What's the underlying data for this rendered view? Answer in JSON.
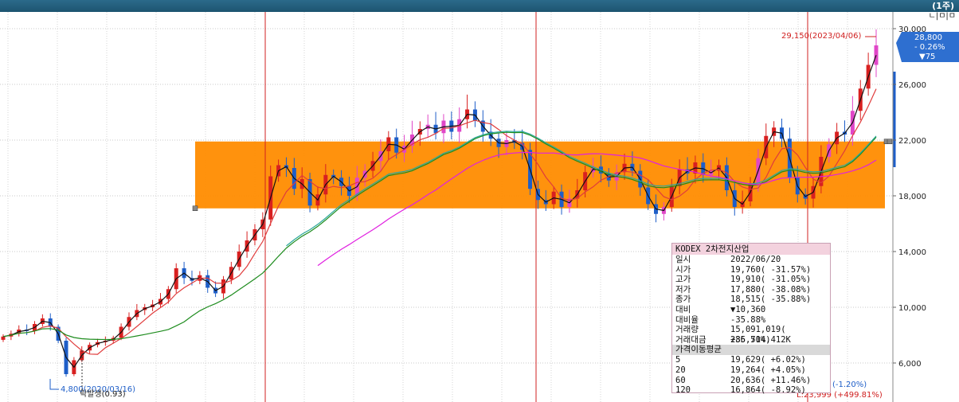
{
  "header": {
    "period": "(1주)",
    "window_controls": "ㄴ|ㅁ|ㅁ"
  },
  "colors": {
    "topbar": "#1d5470",
    "up": "#d82020",
    "down": "#1e5ec8",
    "up_pink": "#e046c8",
    "band": "#ff8c00",
    "ma5": "#111111",
    "ma20": "#e03c3c",
    "ma60": "#1e8c1e",
    "ma120": "#e020e0",
    "ma_teal": "#2aa89a"
  },
  "chart_data": {
    "type": "candlestick",
    "title": "KODEX 2차전지산업",
    "y_axis": {
      "ticks": [
        6000,
        10000,
        14000,
        18000,
        22000,
        26000,
        30000
      ],
      "tick_labels": [
        "6,000",
        "10,000",
        "14,000",
        "18,000",
        "22,000",
        "26,000",
        "30,000"
      ],
      "range": [
        3000,
        31000
      ],
      "position": "right"
    },
    "band": {
      "low": 17100,
      "high": 21900
    },
    "period_lines_count": 4,
    "current_price": {
      "value": "28,800",
      "change": "- 0.26%",
      "diff": "▼75"
    },
    "annotations": {
      "high": "29,150(2023/04/06)",
      "low": "4,800(2020/03/16)",
      "event": "락발생(0.93)",
      "right_pct": "(-1.20%)",
      "bottom_right": "L:23,999 (+499.81%)"
    },
    "series": [
      {
        "name": "5",
        "values": []
      },
      {
        "name": "20",
        "values": []
      },
      {
        "name": "60",
        "values": []
      },
      {
        "name": "120",
        "values": []
      }
    ],
    "close_path": [
      7900,
      8100,
      8400,
      8300,
      8800,
      9200,
      8600,
      7600,
      5200,
      6200,
      6900,
      7300,
      7500,
      7600,
      7800,
      8600,
      9300,
      9800,
      10000,
      10200,
      10600,
      11300,
      12800,
      12100,
      11900,
      12300,
      11400,
      11000,
      12000,
      12900,
      14000,
      14800,
      15600,
      16300,
      19400,
      20200,
      20000,
      18500,
      19200,
      17300,
      18100,
      19500,
      19300,
      18700,
      18000,
      19300,
      19800,
      20500,
      21200,
      22200,
      21100,
      21600,
      22400,
      22800,
      23100,
      22500,
      23400,
      22600,
      23500,
      24200,
      23400,
      22600,
      22100,
      21500,
      22000,
      21800,
      21300,
      18500,
      17700,
      17400,
      18300,
      17200,
      17800,
      18400,
      19700,
      20100,
      19600,
      19100,
      19700,
      20300,
      19800,
      18600,
      17400,
      16700,
      17200,
      18700,
      19900,
      19600,
      20400,
      19500,
      19800,
      20200,
      18400,
      17200,
      17600,
      18900,
      20700,
      22300,
      22900,
      22100,
      19300,
      18100,
      17800,
      18700,
      20800,
      21700,
      22600,
      22400,
      24100,
      25700,
      27400,
      28800
    ]
  },
  "tooltip": {
    "name": "KODEX 2차전지산업",
    "rows": [
      {
        "label": "일시",
        "value": "2022/06/20"
      },
      {
        "label": "시가",
        "value": "19,760( -31.57%)"
      },
      {
        "label": "고가",
        "value": "19,910( -31.05%)"
      },
      {
        "label": "저가",
        "value": "17,880( -38.08%)"
      },
      {
        "label": "종가",
        "value": "18,515( -35.88%)"
      },
      {
        "label": "대비",
        "value": "▼10,360"
      },
      {
        "label": "대비율",
        "value": "-35.88%"
      },
      {
        "label": "거래량",
        "value": "15,091,019( +36.71%)"
      },
      {
        "label": "거래대금",
        "value": "285,504,412K"
      }
    ],
    "ma_title": "가격이동평균",
    "ma_rows": [
      {
        "label": "5",
        "value": "19,629( +6.02%)"
      },
      {
        "label": "20",
        "value": "19,264( +4.05%)"
      },
      {
        "label": "60",
        "value": "20,636( +11.46%)"
      },
      {
        "label": "120",
        "value": "16,864( -8.92%)"
      }
    ]
  }
}
